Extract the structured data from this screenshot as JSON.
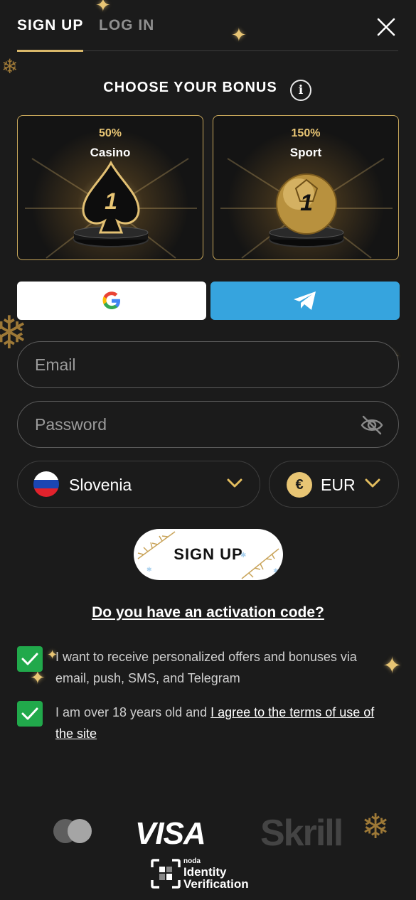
{
  "tabs": {
    "signup": "SIGN UP",
    "login": "LOG IN"
  },
  "bonus": {
    "title": "CHOOSE YOUR BONUS",
    "cards": [
      {
        "percent": "50%",
        "name": "Casino",
        "badge": "1"
      },
      {
        "percent": "150%",
        "name": "Sport",
        "badge": "1"
      }
    ]
  },
  "form": {
    "email_placeholder": "Email",
    "password_placeholder": "Password",
    "country": "Slovenia",
    "currency": "EUR",
    "currency_symbol": "€",
    "submit": "SIGN UP",
    "activation_link": "Do you have an activation code?"
  },
  "consents": {
    "offers_text": "I want to receive personalized offers and bonuses via email, push, SMS, and Telegram",
    "age_text": "I am over 18 years old and ",
    "terms_link": "I agree to the terms of use of the site"
  },
  "payments": {
    "visa": "VISA",
    "skrill": "Skrill",
    "noda_small": "noda",
    "noda_big_line1": "Identity",
    "noda_big_line2": "Verification"
  },
  "icons": [
    "close-icon",
    "info-icon",
    "google-icon",
    "telegram-icon",
    "eye-off-icon",
    "chevron-down-icon",
    "check-icon"
  ],
  "colors": {
    "accent": "#d9b86a",
    "telegram": "#36a4de",
    "checkbox": "#21a94b",
    "background": "#1b1b1b"
  }
}
